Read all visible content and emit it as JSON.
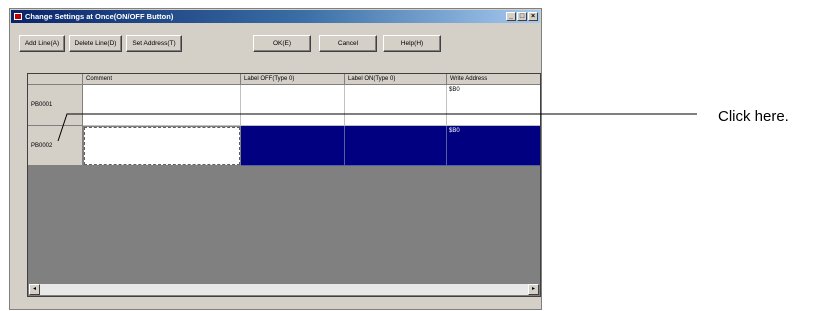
{
  "window": {
    "title": "Change Settings at Once(ON/OFF Button)",
    "controls": {
      "minimize": "_",
      "maximize": "□",
      "close": "×"
    }
  },
  "toolbar": {
    "add_line": "Add Line(A)",
    "delete_line": "Delete Line(D)",
    "set_address": "Set Address(T)",
    "ok": "OK(E)",
    "cancel": "Cancel",
    "help": "Help(H)"
  },
  "table": {
    "columns": [
      "",
      "Comment",
      "Label OFF(Type 0)",
      "Label ON(Type 0)",
      "Write Address"
    ],
    "rows": [
      {
        "id": "PB0001",
        "comment": "",
        "label_off": "",
        "label_on": "",
        "write_address": "$B0",
        "selected": false
      },
      {
        "id": "PB0002",
        "comment": "",
        "label_off": "",
        "label_on": "",
        "write_address": "$B0",
        "selected": true
      }
    ]
  },
  "scrollbar": {
    "left": "◂",
    "right": "▸"
  },
  "callout": {
    "text": "Click here."
  },
  "colors": {
    "selection": "#000080",
    "titlebar": "#0a246a",
    "grid_background": "#808080"
  }
}
